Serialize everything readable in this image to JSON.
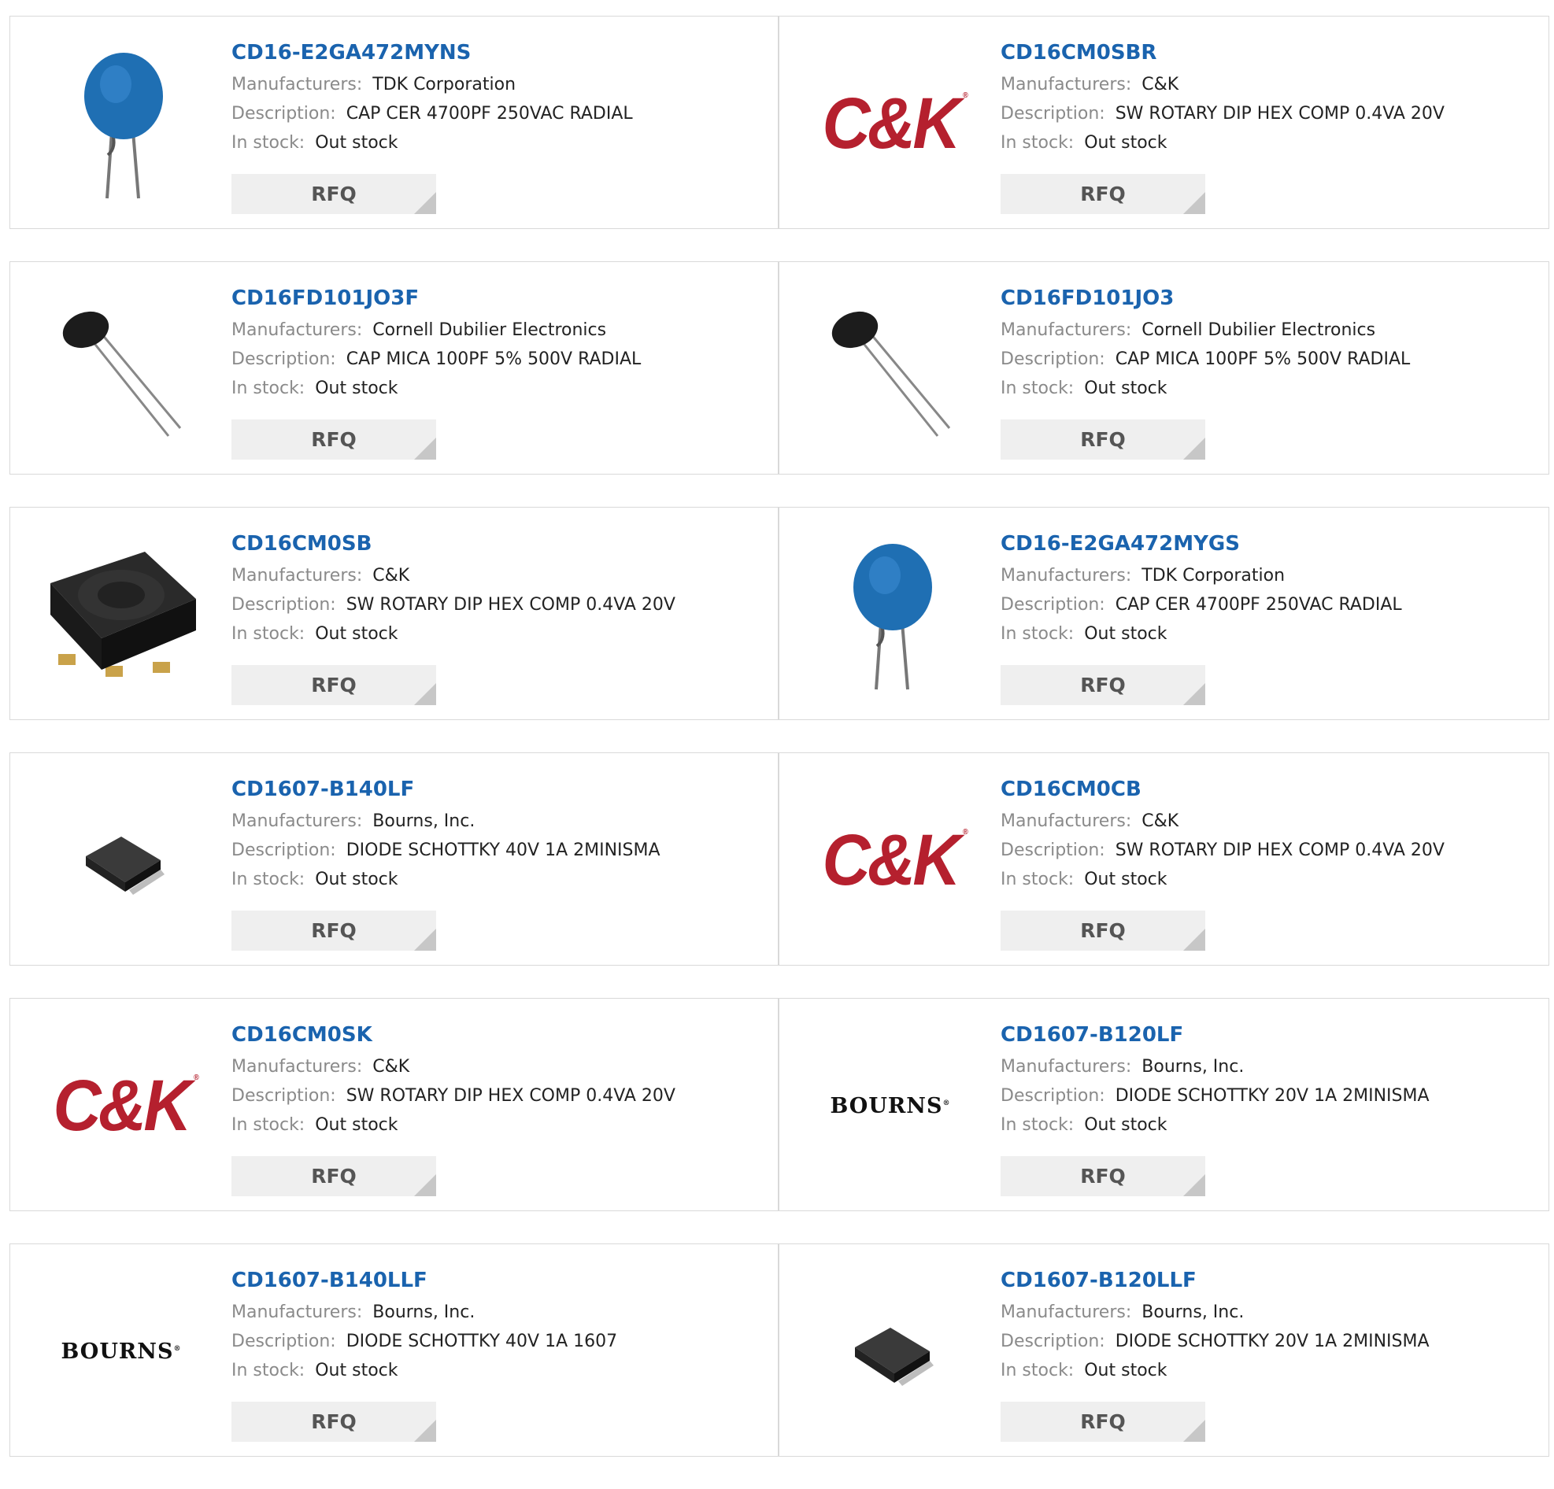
{
  "labels": {
    "manufacturers": "Manufacturers:",
    "description": "Description:",
    "in_stock": "In stock:",
    "rfq": "RFQ"
  },
  "logos": {
    "ck": "C&K",
    "bourns": "BOURNS"
  },
  "products": [
    {
      "part": "CD16-E2GA472MYNS",
      "manufacturer": "TDK Corporation",
      "description": "CAP CER 4700PF 250VAC RADIAL",
      "stock": "Out stock",
      "image": "blue-ceramic-capacitor"
    },
    {
      "part": "CD16CM0SBR",
      "manufacturer": "C&K",
      "description": "SW ROTARY DIP HEX COMP 0.4VA 20V",
      "stock": "Out stock",
      "image": "ck-logo"
    },
    {
      "part": "CD16FD101JO3F",
      "manufacturer": "Cornell Dubilier Electronics",
      "description": "CAP MICA 100PF 5% 500V RADIAL",
      "stock": "Out stock",
      "image": "mica-capacitor"
    },
    {
      "part": "CD16FD101JO3",
      "manufacturer": "Cornell Dubilier Electronics",
      "description": "CAP MICA 100PF 5% 500V RADIAL",
      "stock": "Out stock",
      "image": "mica-capacitor"
    },
    {
      "part": "CD16CM0SB",
      "manufacturer": "C&K",
      "description": "SW ROTARY DIP HEX COMP 0.4VA 20V",
      "stock": "Out stock",
      "image": "rotary-dip-switch"
    },
    {
      "part": "CD16-E2GA472MYGS",
      "manufacturer": "TDK Corporation",
      "description": "CAP CER 4700PF 250VAC RADIAL",
      "stock": "Out stock",
      "image": "blue-ceramic-capacitor"
    },
    {
      "part": "CD1607-B140LF",
      "manufacturer": "Bourns, Inc.",
      "description": "DIODE SCHOTTKY 40V 1A 2MINISMA",
      "stock": "Out stock",
      "image": "smd-diode"
    },
    {
      "part": "CD16CM0CB",
      "manufacturer": "C&K",
      "description": "SW ROTARY DIP HEX COMP 0.4VA 20V",
      "stock": "Out stock",
      "image": "ck-logo"
    },
    {
      "part": "CD16CM0SK",
      "manufacturer": "C&K",
      "description": "SW ROTARY DIP HEX COMP 0.4VA 20V",
      "stock": "Out stock",
      "image": "ck-logo"
    },
    {
      "part": "CD1607-B120LF",
      "manufacturer": "Bourns, Inc.",
      "description": "DIODE SCHOTTKY 20V 1A 2MINISMA",
      "stock": "Out stock",
      "image": "bourns-logo"
    },
    {
      "part": "CD1607-B140LLF",
      "manufacturer": "Bourns, Inc.",
      "description": "DIODE SCHOTTKY 40V 1A 1607",
      "stock": "Out stock",
      "image": "bourns-logo"
    },
    {
      "part": "CD1607-B120LLF",
      "manufacturer": "Bourns, Inc.",
      "description": "DIODE SCHOTTKY 20V 1A 2MINISMA",
      "stock": "Out stock",
      "image": "smd-diode"
    }
  ]
}
